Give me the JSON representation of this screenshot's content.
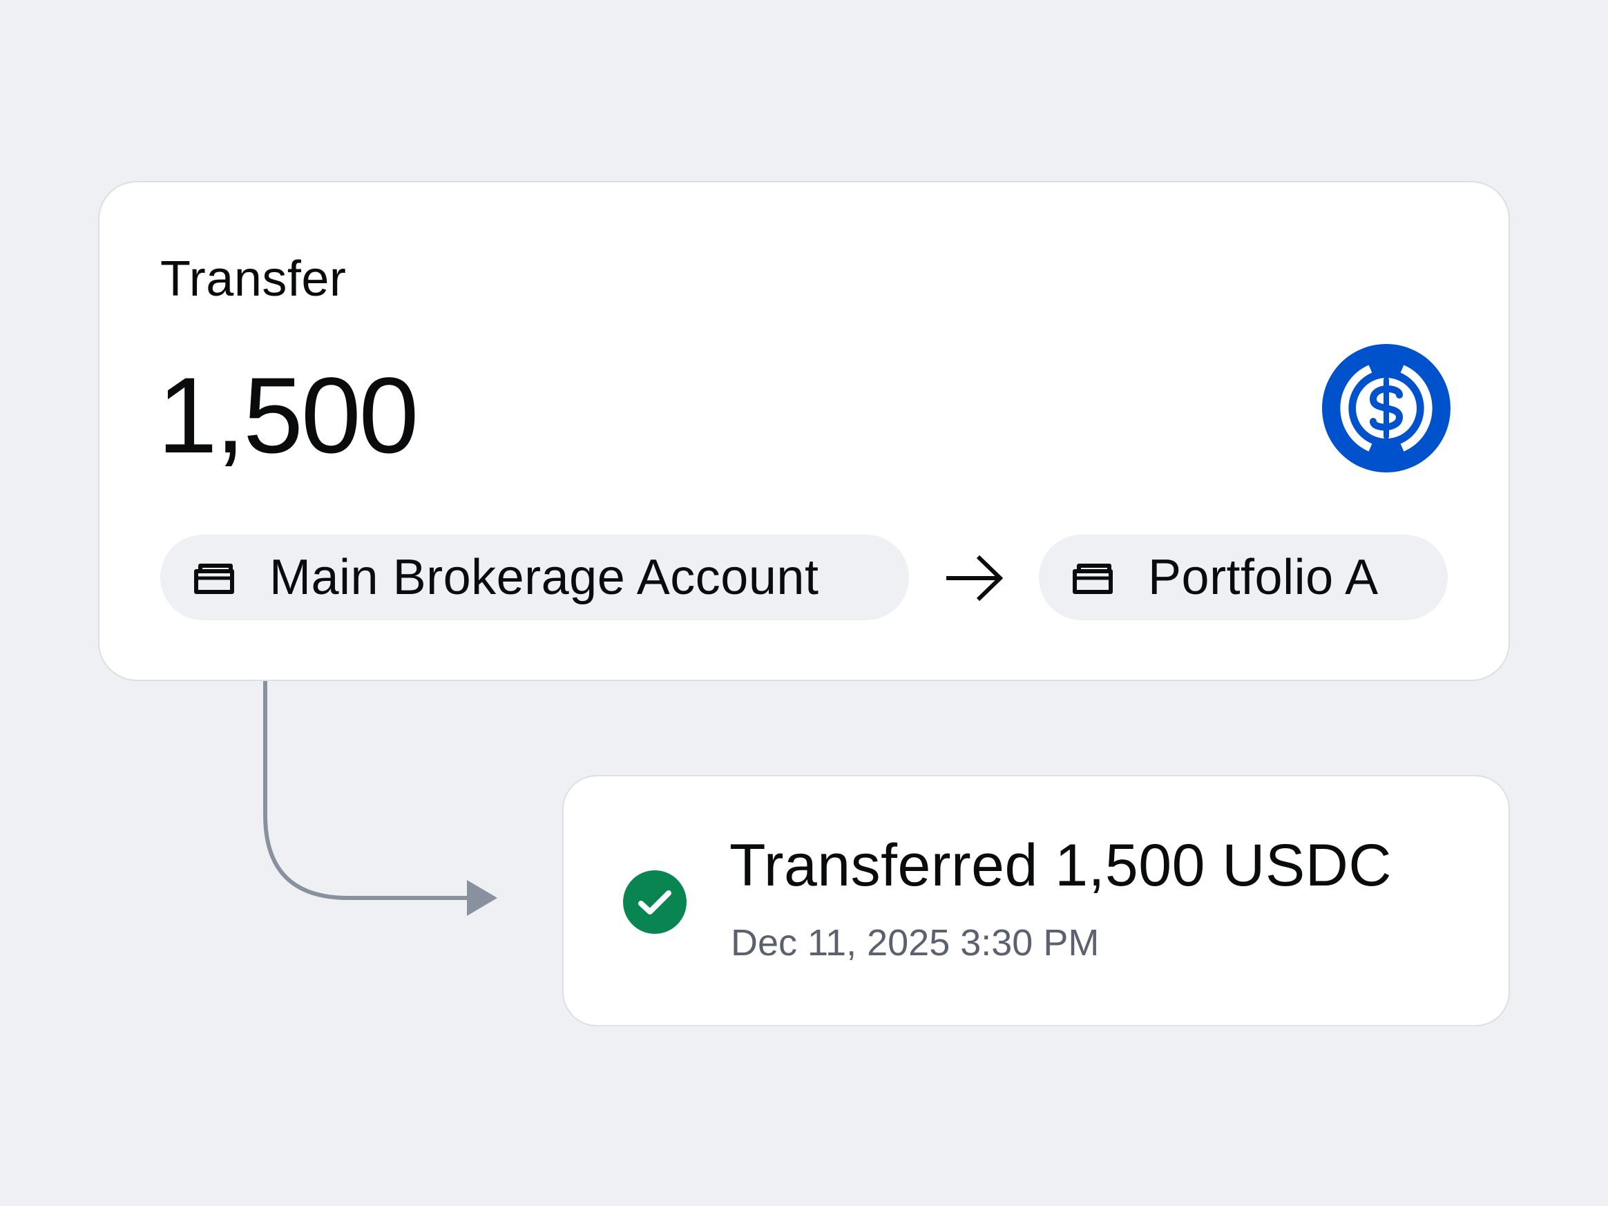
{
  "transfer": {
    "label": "Transfer",
    "amount": "1,500",
    "asset_icon": "usdc-coin-icon",
    "from": {
      "icon": "wallet-icon",
      "label": "Main Brokerage Account"
    },
    "direction_icon": "arrow-right-icon",
    "to": {
      "icon": "wallet-icon",
      "label": "Portfolio A"
    }
  },
  "result": {
    "status_icon": "check-circle-icon",
    "title": "Transferred 1,500 USDC",
    "timestamp": "Dec 11, 2025 3:30 PM"
  },
  "colors": {
    "background": "#eef0f3",
    "card": "#ffffff",
    "usdc_blue": "#0052cc",
    "success_green": "#098551",
    "connector": "#8a919e",
    "secondary_text": "#5b616e"
  }
}
